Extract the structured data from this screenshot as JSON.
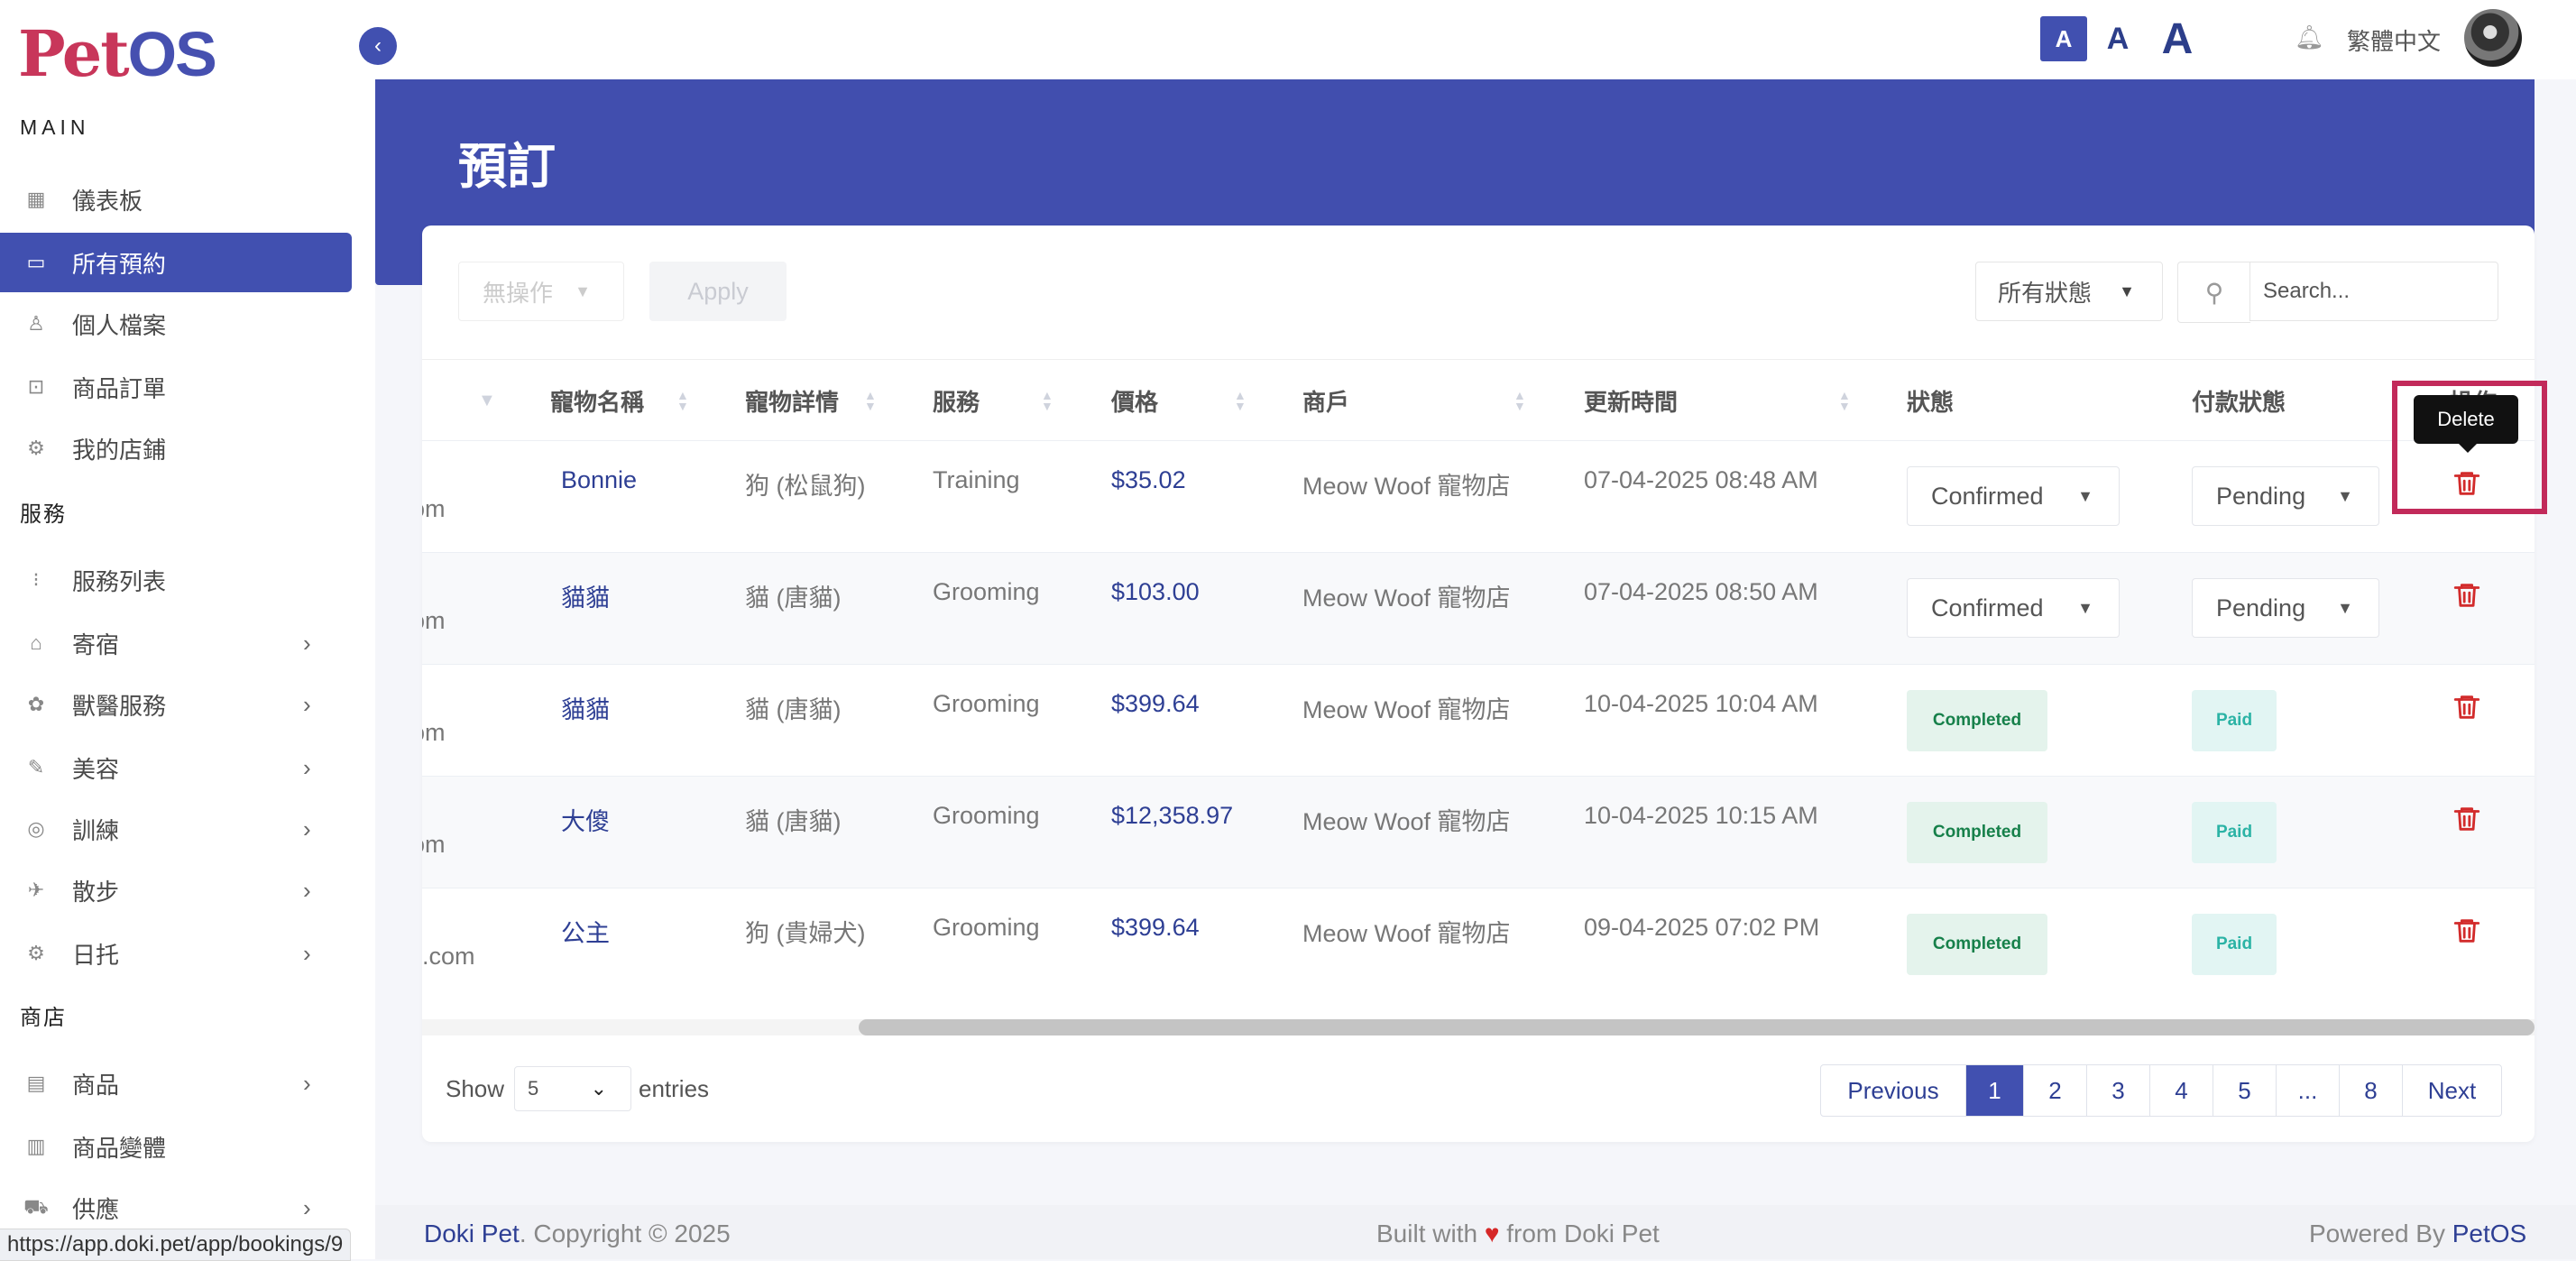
{
  "brand": {
    "logo_pet": "Pet",
    "logo_os": "OS"
  },
  "sidebar": {
    "section_main": "MAIN",
    "section_services": "服務",
    "section_shop": "商店",
    "items": [
      {
        "label": "儀表板",
        "icon": "dashboard-icon"
      },
      {
        "label": "所有預約",
        "icon": "calendar-icon",
        "active": true
      },
      {
        "label": "個人檔案",
        "icon": "user-icon"
      },
      {
        "label": "商品訂單",
        "icon": "bag-icon"
      },
      {
        "label": "我的店鋪",
        "icon": "store-icon"
      },
      {
        "label": "服務列表",
        "icon": "list-icon"
      },
      {
        "label": "寄宿",
        "icon": "home-icon"
      },
      {
        "label": "獸醫服務",
        "icon": "vet-icon"
      },
      {
        "label": "美容",
        "icon": "brush-icon"
      },
      {
        "label": "訓練",
        "icon": "training-icon"
      },
      {
        "label": "散步",
        "icon": "walk-icon"
      },
      {
        "label": "日托",
        "icon": "daycare-icon"
      },
      {
        "label": "商品",
        "icon": "shop-icon"
      },
      {
        "label": "商品變體",
        "icon": "variant-icon"
      },
      {
        "label": "供應",
        "icon": "truck-icon"
      }
    ]
  },
  "topbar": {
    "font_small": "A",
    "font_medium": "A",
    "font_large": "A",
    "language": "繁體中文"
  },
  "page": {
    "title": "預訂"
  },
  "toolbar": {
    "bulk_action": "無操作",
    "apply_label": "Apply",
    "status_filter": "所有狀態",
    "search_placeholder": "Search..."
  },
  "table": {
    "headers": [
      "寵物名稱",
      "寵物詳情",
      "服務",
      "價格",
      "商戶",
      "更新時間",
      "狀態",
      "付款狀態",
      "操作"
    ],
    "rows": [
      {
        "email_tail": "om",
        "pet": "Bonnie",
        "details": "狗 (松鼠狗)",
        "service": "Training",
        "price": "$35.02",
        "merchant": "Meow Woof 寵物店",
        "updated": "07-04-2025 08:48 AM",
        "status": "Confirmed",
        "payment": "Pending",
        "status_type": "dropdown"
      },
      {
        "email_tail": "om",
        "pet": "貓貓",
        "details": "貓 (唐貓)",
        "service": "Grooming",
        "price": "$103.00",
        "merchant": "Meow Woof 寵物店",
        "updated": "07-04-2025 08:50 AM",
        "status": "Confirmed",
        "payment": "Pending",
        "status_type": "dropdown"
      },
      {
        "email_tail": "om",
        "pet": "貓貓",
        "details": "貓 (唐貓)",
        "service": "Grooming",
        "price": "$399.64",
        "merchant": "Meow Woof 寵物店",
        "updated": "10-04-2025 10:04 AM",
        "status": "Completed",
        "payment": "Paid",
        "status_type": "badge"
      },
      {
        "email_tail": "om",
        "pet": "大傻",
        "details": "貓 (唐貓)",
        "service": "Grooming",
        "price": "$12,358.97",
        "merchant": "Meow Woof 寵物店",
        "updated": "10-04-2025 10:15 AM",
        "status": "Completed",
        "payment": "Paid",
        "status_type": "badge"
      },
      {
        "email_tail": "il.com",
        "pet": "公主",
        "details": "狗 (貴婦犬)",
        "service": "Grooming",
        "price": "$399.64",
        "merchant": "Meow Woof 寵物店",
        "updated": "09-04-2025 07:02 PM",
        "status": "Completed",
        "payment": "Paid",
        "status_type": "badge"
      }
    ],
    "delete_tooltip": "Delete"
  },
  "pagination": {
    "show_label": "Show",
    "per_page": "5",
    "entries_label": "entries",
    "previous": "Previous",
    "pages": [
      "1",
      "2",
      "3",
      "4",
      "5",
      "...",
      "8"
    ],
    "current": "1",
    "next": "Next"
  },
  "footer": {
    "brand": "Doki Pet",
    "copyright": ". Copyright © 2025",
    "built_pre": "Built with ",
    "heart": "♥",
    "built_post": " from Doki Pet",
    "powered_pre": "Powered By ",
    "powered_brand": "PetOS"
  },
  "status_url": "https://app.doki.pet/app/bookings/9",
  "colors": {
    "primary": "#4150b0",
    "brand_red": "#c8365a",
    "delete_red": "#d22b2b",
    "highlight": "#c22a5a"
  }
}
